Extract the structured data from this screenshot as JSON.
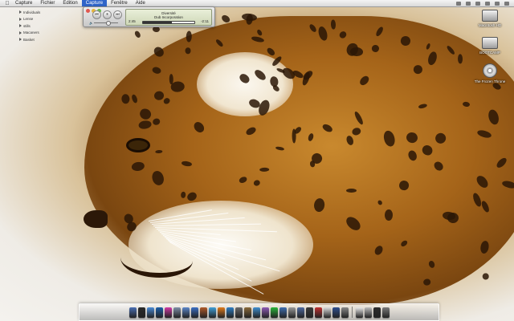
{
  "menubar": {
    "apple": "",
    "items": [
      {
        "label": "Capture",
        "active": false
      },
      {
        "label": "Fichier",
        "active": false
      },
      {
        "label": "Edition",
        "active": false
      },
      {
        "label": "Capture",
        "active": true
      },
      {
        "label": "Fenêtre",
        "active": false
      },
      {
        "label": "Aide",
        "active": false
      }
    ]
  },
  "sidebar_list": [
    "Individuals",
    "Lense",
    "stills",
    "Macaners",
    "Basket"
  ],
  "player": {
    "track_title": "Diversité",
    "track_artist": "Dub Incorporation",
    "elapsed": "2:45",
    "remaining": "-2:11",
    "progress": 0.56,
    "volume": 0.55
  },
  "desktop_icons": [
    {
      "label": "Macintosh HD",
      "kind": "drive"
    },
    {
      "label": "BOOTCAMP",
      "kind": "drive"
    },
    {
      "label": "The Frozen Throne",
      "kind": "disc"
    }
  ],
  "dock": {
    "colors": [
      "#4a6fb3",
      "#2a2a2a",
      "#4a8bd6",
      "#1c5fa8",
      "#d23aa6",
      "#7f8fa8",
      "#5b86c9",
      "#3a6fc4",
      "#b05a2a",
      "#3fa0d9",
      "#e07a1a",
      "#2f7dc2",
      "#6b6b6b",
      "#8a6a3a",
      "#3f8fd0",
      "#8d5ab5",
      "#2ab53a",
      "#3f6fb0",
      "#9a9a9a",
      "#4f6aa0",
      "#3a3a3a",
      "#c03030",
      "#dddddd",
      "#2f4f8f",
      "#888888",
      "#eaeaea",
      "#bdbdbd",
      "#2c2c2c",
      "#7a7a7a"
    ]
  }
}
